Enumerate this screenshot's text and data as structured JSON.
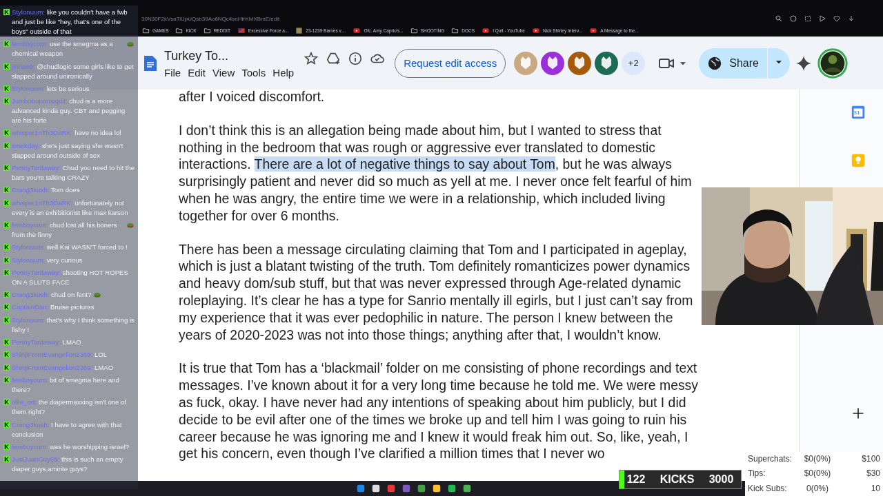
{
  "browser": {
    "address": "30N30F2kVsaTiUpUQsb39Ao6NQc4snHfrKMXBmE/edit",
    "bookmarks": [
      {
        "label": "GAMES",
        "kind": "folder"
      },
      {
        "label": "KICK",
        "kind": "folder"
      },
      {
        "label": "REDDIT",
        "kind": "folder"
      },
      {
        "label": "Excessive Force a...",
        "kind": "flag"
      },
      {
        "label": "23-1239 Barnes v....",
        "kind": "doc"
      },
      {
        "label": "Ofc. Amy Caprio's...",
        "kind": "video"
      },
      {
        "label": "SHOOTING",
        "kind": "folder"
      },
      {
        "label": "DOCS",
        "kind": "folder"
      },
      {
        "label": "I Quit - YouTube",
        "kind": "video"
      },
      {
        "label": "Nick Shirley Interv...",
        "kind": "video"
      },
      {
        "label": "A Message to the...",
        "kind": "video"
      }
    ]
  },
  "doc": {
    "title": "Turkey To...",
    "menu": [
      "File",
      "Edit",
      "View",
      "Tools",
      "Help"
    ],
    "request_button": "Request edit access",
    "more_viewers": "+2",
    "share_button": "Share",
    "viewers": [
      {
        "color": "#c9a882"
      },
      {
        "color": "#9b2fd9"
      },
      {
        "color": "#a45a0a"
      },
      {
        "color": "#1d6b55"
      }
    ],
    "paragraphs": [
      [
        {
          "text": "after I voiced discomfort.",
          "selected": false
        }
      ],
      [
        {
          "text": "I don’t think this is an allegation being made about him, but I wanted to stress that nothing in the bedroom that was rough or aggressive ever translated to domestic interactions. ",
          "selected": false
        },
        {
          "text": "There are a lot of negative things to say about Tom",
          "selected": true
        },
        {
          "text": ", but he was always surprisingly patient and never did so much as yell at me. I never once felt fearful of him when he was angry, the entire time we were in a relationship, which included living together for over 6 months.",
          "selected": false
        }
      ],
      [
        {
          "text": "There has been a message circulating claiming that Tom and I participated in ageplay, which is just a blatant twisting of the truth. Tom definitely romanticizes power dynamics and heavy dom/sub stuff, but that was never expressed through Age-related dynamic roleplaying. It’s clear he has a type for Sanrio mentally ill egirls, but I just can’t say from my experience that it was ever pedophilic in nature. The person I knew between the years of 2020-2023 was not into those things; anything after that, I wouldn’t know.",
          "selected": false
        }
      ],
      [
        {
          "text": "It is true that Tom has a ‘blackmail’ folder on me consisting of phone recordings and text messages. I’ve known about it for a very long time because he told me. We were messy as fuck, okay. I have never had any intentions of speaking about him publicly, but I did decide to be evil after one of the times we broke up and tell him I was going to ruin his career because he was ignoring me and I knew it would freak him out. So, like, yeah, I get his concern, even though I’ve clarified a million times that I never wo",
          "selected": false
        }
      ]
    ]
  },
  "chat": [
    {
      "user": "Stylonuum:",
      "text": "like you couldn't have a fwb and just be like \"hey, that's one of the boys\" outside of that",
      "emote": false
    },
    {
      "user": "femboycum:",
      "text": "use the smegma as a chemical weapon",
      "emote": true
    },
    {
      "user": "jirina69:",
      "text": "@chudlogic some girls like to get slapped around unironically",
      "emote": false
    },
    {
      "user": "Stylonuum:",
      "text": "lets be serious",
      "emote": false
    },
    {
      "user": "Jumbobananasplit:",
      "text": "chud is a more advanced kinda guy. CBT and pegging are his forte",
      "emote": false
    },
    {
      "user": "whisper1nTh3DaRK:",
      "text": "have no idea lol",
      "emote": false
    },
    {
      "user": "smekday:",
      "text": "she's just saying she wasn't slapped around outside of sex",
      "emote": false
    },
    {
      "user": "PennyTardaway:",
      "text": "Chud you need to hit the bars you're talking CRAZY",
      "emote": false
    },
    {
      "user": "Crang3kush:",
      "text": "Tom does",
      "emote": false
    },
    {
      "user": "whisper1nTh3DaRK:",
      "text": "unfortunately not every is an exhibitionist like max karson",
      "emote": false
    },
    {
      "user": "femboycum:",
      "text": "chud lost all his boners from the finny",
      "emote": true
    },
    {
      "user": "Stylonuum:",
      "text": "well Kai WASN'T forced to !",
      "emote": false
    },
    {
      "user": "Stylonuum:",
      "text": "very curious",
      "emote": false
    },
    {
      "user": "PennyTardaway:",
      "text": "shooting HOT ROPES ON A SLUTS FACE",
      "emote": false
    },
    {
      "user": "Crang3kush:",
      "text": "chud on fent?",
      "emote": true
    },
    {
      "user": "CaptainDan:",
      "text": "Bruise pictures",
      "emote": false
    },
    {
      "user": "Stylonuum:",
      "text": "that's why I think something is fishy !",
      "emote": false
    },
    {
      "user": "PennyTardaway:",
      "text": "LMAO",
      "emote": false
    },
    {
      "user": "ShinjiFromEvangelion2369:",
      "text": "LOL",
      "emote": false
    },
    {
      "user": "ShinjiFromEvangelion2369:",
      "text": "LMAO",
      "emote": false
    },
    {
      "user": "femboycum:",
      "text": "bit of smegma here and there?",
      "emote": false
    },
    {
      "user": "ollie_ort:",
      "text": "the diapermaxxing isn't one of them right?",
      "emote": false
    },
    {
      "user": "Crang3kush:",
      "text": "I have to agree with that conclusion",
      "emote": false
    },
    {
      "user": "femboycum:",
      "text": "was he worshipping israel?",
      "emote": false
    },
    {
      "user": "JustJuanGuy69:",
      "text": "this is such an empty diaper guys,amirite guys?",
      "emote": false
    }
  ],
  "kicks_goal": {
    "current": "122",
    "label": "KICKS",
    "target": "3000",
    "level": 0.04
  },
  "stats": [
    {
      "label": "Superchats:",
      "value": "$0(0%)",
      "goal": "$100"
    },
    {
      "label": "Tips:",
      "value": "$0(0%)",
      "goal": "$30"
    },
    {
      "label": "Kick Subs:",
      "value": "0(0%)",
      "goal": "10"
    }
  ],
  "calendar_day": "31"
}
